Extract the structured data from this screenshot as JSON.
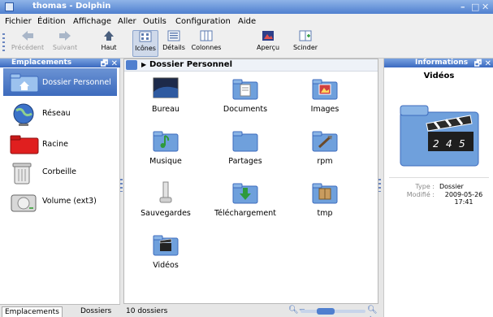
{
  "window": {
    "title": "thomas - Dolphin",
    "minimize": "–",
    "maximize": "□",
    "close": "✕"
  },
  "menubar": [
    "Fichier",
    "Édition",
    "Affichage",
    "Aller",
    "Outils",
    "Configuration",
    "Aide"
  ],
  "toolbar": {
    "back": "Précédent",
    "forward": "Suivant",
    "up": "Haut",
    "icons": "Icônes",
    "details": "Détails",
    "columns": "Colonnes",
    "preview": "Aperçu",
    "split": "Scinder"
  },
  "places": {
    "title": "Emplacements",
    "items": [
      {
        "label": "Dossier Personnel",
        "icon": "home-folder-icon",
        "selected": true
      },
      {
        "label": "Réseau",
        "icon": "globe-icon"
      },
      {
        "label": "Racine",
        "icon": "red-folder-icon"
      },
      {
        "label": "Corbeille",
        "icon": "trash-icon"
      },
      {
        "label": "Volume (ext3)",
        "icon": "hard-drive-icon"
      }
    ],
    "tabs": [
      "Emplacements",
      "Dossiers"
    ]
  },
  "breadcrumb": {
    "path": "Dossier Personnel"
  },
  "files": [
    {
      "name": "Bureau",
      "icon": "desktop-icon"
    },
    {
      "name": "Documents",
      "icon": "documents-folder-icon"
    },
    {
      "name": "Images",
      "icon": "images-folder-icon"
    },
    {
      "name": "Musique",
      "icon": "music-folder-icon"
    },
    {
      "name": "Partages",
      "icon": "folder-icon"
    },
    {
      "name": "rpm",
      "icon": "tools-folder-icon"
    },
    {
      "name": "Sauvegardes",
      "icon": "backup-icon"
    },
    {
      "name": "Téléchargement",
      "icon": "download-folder-icon"
    },
    {
      "name": "tmp",
      "icon": "box-folder-icon"
    },
    {
      "name": "Vidéos",
      "icon": "videos-folder-icon"
    }
  ],
  "status": {
    "count": "10 dossiers",
    "zoom_level": 0.35
  },
  "info": {
    "title": "Informations",
    "name": "Vidéos",
    "clapper_numbers": [
      "2",
      "4",
      "5"
    ],
    "type_label": "Type :",
    "type_value": "Dossier",
    "modified_label": "Modifié :",
    "modified_value": "2009-05-26 17:41"
  },
  "colors": {
    "accent": "#4f7fcf",
    "folder": "#6fa0dc",
    "selection": "#3d6bbd"
  }
}
